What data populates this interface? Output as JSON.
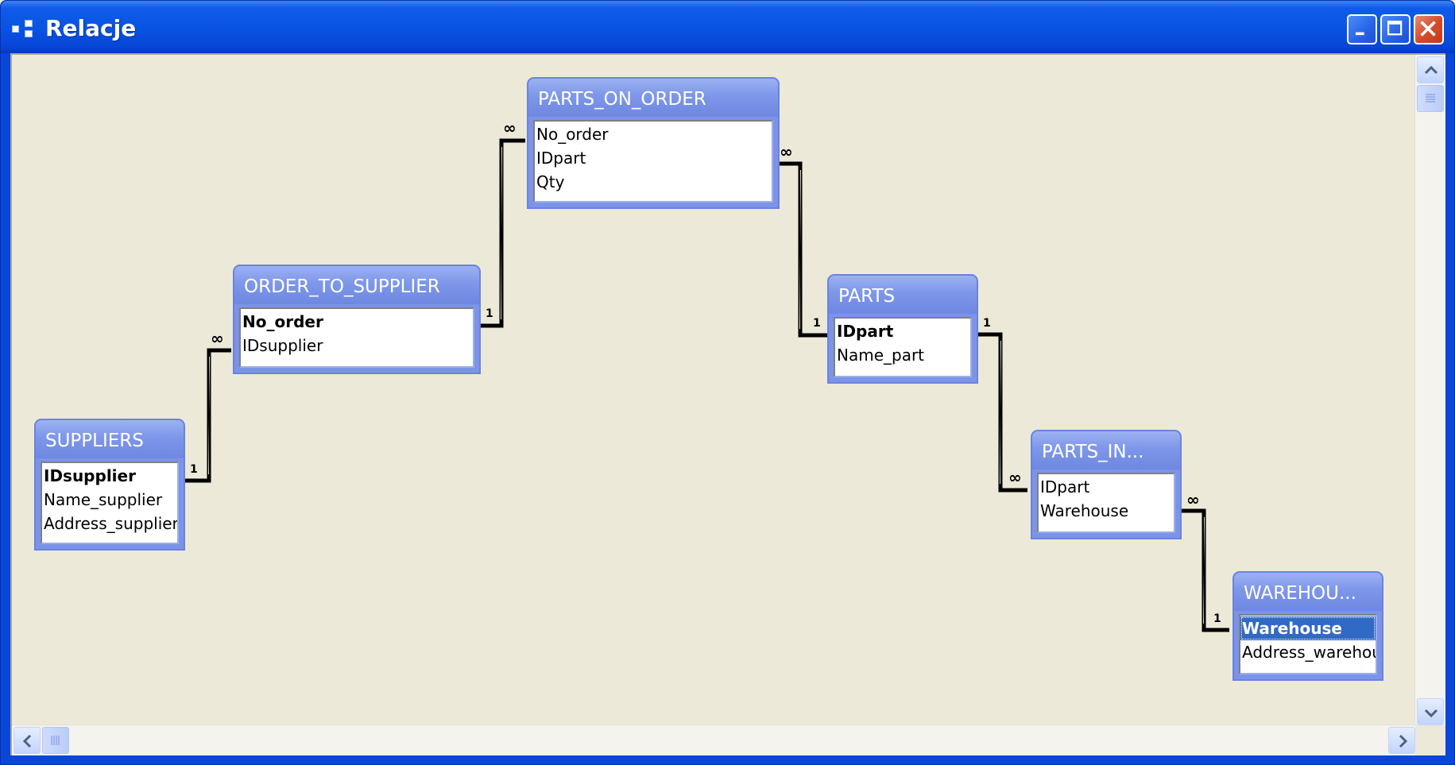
{
  "window": {
    "title": "Relacje"
  },
  "tables": {
    "parts_on_order": {
      "name": "PARTS_ON_ORDER",
      "fields": [
        "No_order",
        "IDpart",
        "Qty"
      ]
    },
    "order_to_supplier": {
      "name": "ORDER_TO_SUPPLIER",
      "fields": [
        "No_order",
        "IDsupplier"
      ]
    },
    "suppliers": {
      "name": "SUPPLIERS",
      "fields": [
        "IDsupplier",
        "Name_supplier",
        "Address_supplier"
      ]
    },
    "parts": {
      "name": "PARTS",
      "fields": [
        "IDpart",
        "Name_part"
      ]
    },
    "parts_in": {
      "name": "PARTS_IN...",
      "fields": [
        "IDpart",
        "Warehouse"
      ]
    },
    "warehou": {
      "name": "WAREHOU...",
      "fields": [
        "Warehouse",
        "Address_warehou"
      ]
    }
  },
  "cardinality": {
    "one": "1",
    "many": "∞"
  },
  "colors": {
    "title_bar": "#0A54E4",
    "client_bg": "#ECE9D8",
    "table_header": "#7F98EA",
    "selection": "#316AC5"
  },
  "icons": [
    "relationships-window-icon",
    "minimize-icon",
    "maximize-icon",
    "close-icon",
    "scroll-up-icon",
    "scroll-down-icon",
    "scroll-left-icon",
    "scroll-right-icon"
  ]
}
